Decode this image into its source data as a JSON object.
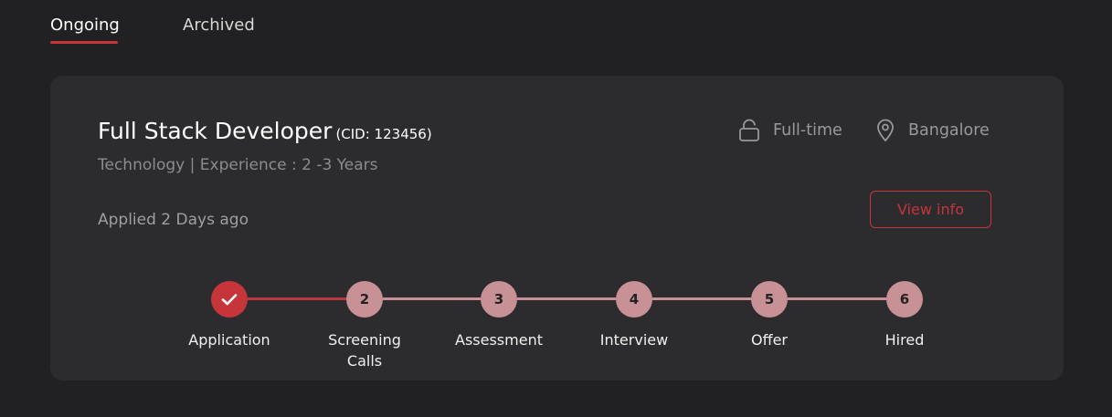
{
  "tabs": [
    {
      "label": "Ongoing",
      "active": true
    },
    {
      "label": "Archived",
      "active": false
    }
  ],
  "job": {
    "title": "Full Stack Developer",
    "cid": "(CID: 123456)",
    "meta": "Technology | Experience : 2 -3 Years",
    "applied": "Applied 2 Days ago",
    "type": "Full-time",
    "type_icon": "lock-icon",
    "location": "Bangalore",
    "location_icon": "location-pin-icon",
    "view_info_label": "View info"
  },
  "steps": [
    {
      "number": "✓",
      "label": "Application",
      "label_line2": "",
      "completed": true
    },
    {
      "number": "2",
      "label": "Screening",
      "label_line2": "Calls",
      "completed": false
    },
    {
      "number": "3",
      "label": "Assessment",
      "label_line2": "",
      "completed": false
    },
    {
      "number": "4",
      "label": "Interview",
      "label_line2": "",
      "completed": false
    },
    {
      "number": "5",
      "label": "Offer",
      "label_line2": "",
      "completed": false
    },
    {
      "number": "6",
      "label": "Hired",
      "label_line2": "",
      "completed": false
    }
  ],
  "colors": {
    "accent": "#c6353a",
    "pending_step": "#c79195",
    "background": "#212022",
    "card": "#2c2b2e"
  }
}
